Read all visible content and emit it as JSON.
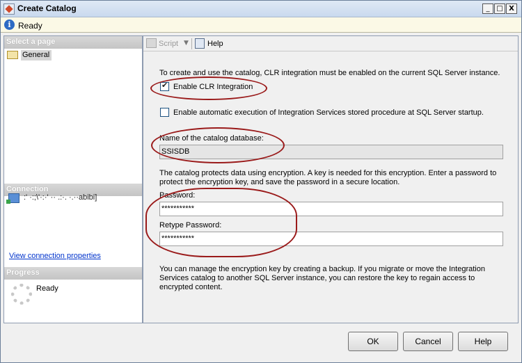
{
  "window": {
    "title": "Create Catalog",
    "controls": [
      "_",
      "□",
      "X"
    ]
  },
  "status": {
    "text": "Ready"
  },
  "left": {
    "select_header": "Select a page",
    "page_item": "General",
    "connection_header": "Connection",
    "connection_text": ":'  ·:;\\'·:·'    ·· .:·. ·.··abibi]",
    "connection_link": "View connection properties",
    "progress_header": "Progress",
    "progress_text": "Ready"
  },
  "toolbar": {
    "script_label": "Script",
    "help_label": "Help"
  },
  "form": {
    "intro": "To create and use the catalog, CLR integration must be enabled on the current SQL Server instance.",
    "clr_label": "Enable CLR Integration",
    "clr_checked": true,
    "auto_label": "Enable automatic execution of Integration Services stored procedure at SQL Server startup.",
    "auto_checked": false,
    "db_label": "Name of the catalog database:",
    "db_value": "SSISDB",
    "encryption_note_1": "The catalog protects data using encryption. A key is needed for this encryption. Enter a password to",
    "encryption_note_2": "protect the encryption key, and save the password in a secure location.",
    "password_label": "Password:",
    "password_value": "***********",
    "retype_label": "Retype Password:",
    "retype_value": "***********",
    "backup_note_1": "You can manage the encryption key by creating a backup. If you migrate or move the Integration",
    "backup_note_2": "Services catalog to another SQL Server instance, you can restore the key to regain access to",
    "backup_note_3": "encrypted content."
  },
  "buttons": {
    "ok": "OK",
    "cancel": "Cancel",
    "help": "Help"
  },
  "colors": {
    "annotation_ring": "#9a1a1a",
    "link": "#0033cc",
    "status_bg": "#fbf9e6"
  }
}
